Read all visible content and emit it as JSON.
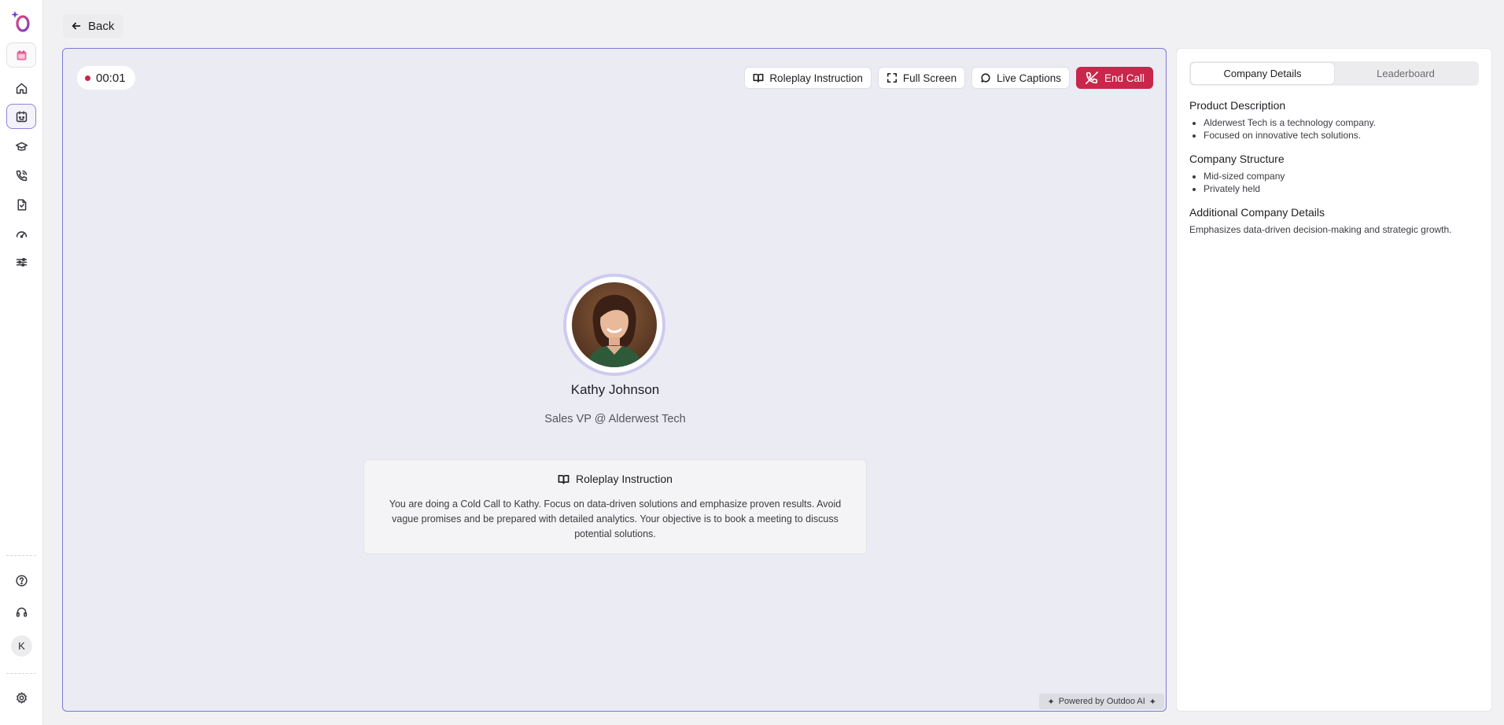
{
  "nav": {
    "items": [
      {
        "name": "home",
        "icon": "home-icon"
      },
      {
        "name": "roleplay",
        "icon": "calendar-bot-icon"
      },
      {
        "name": "learning",
        "icon": "graduation-cap-icon"
      },
      {
        "name": "calls",
        "icon": "phone-call-icon"
      },
      {
        "name": "documents",
        "icon": "file-icon"
      },
      {
        "name": "analytics",
        "icon": "gauge-icon"
      },
      {
        "name": "settings-sliders",
        "icon": "sliders-icon"
      }
    ],
    "user_initial": "K"
  },
  "back": {
    "label": "Back"
  },
  "call": {
    "timer": "00:01",
    "toolbar": {
      "instruction_label": "Roleplay Instruction",
      "fullscreen_label": "Full Screen",
      "captions_label": "Live Captions",
      "end_label": "End Call"
    },
    "person": {
      "name": "Kathy Johnson",
      "role": "Sales VP @ Alderwest Tech"
    },
    "instruction": {
      "title": "Roleplay Instruction",
      "body": "You are doing a Cold Call to Kathy. Focus on data-driven solutions and emphasize proven results. Avoid vague promises and be prepared with detailed analytics. Your objective is to book a meeting to discuss potential solutions."
    },
    "powered_by": "Powered by Outdoo AI"
  },
  "panel": {
    "tabs": [
      "Company Details",
      "Leaderboard"
    ],
    "active_tab": 0,
    "product": {
      "title": "Product Description",
      "items": [
        "Alderwest Tech is a technology company.",
        "Focused on innovative tech solutions."
      ]
    },
    "structure": {
      "title": "Company Structure",
      "items": [
        "Mid-sized company",
        "Privately held"
      ]
    },
    "additional": {
      "title": "Additional Company Details",
      "text": "Emphasizes data-driven decision-making and strategic growth."
    }
  },
  "colors": {
    "accent": "#7d79d0",
    "end_call": "#c8264a",
    "stage_bg": "#ebebf4"
  }
}
